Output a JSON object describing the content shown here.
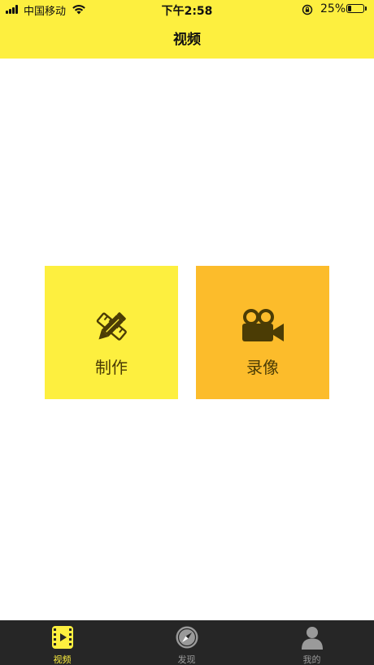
{
  "status_bar": {
    "carrier": "中国移动",
    "time": "下午2:58",
    "battery_percent": "25%",
    "battery_level": 0.25
  },
  "nav": {
    "title": "视频"
  },
  "actions": {
    "make_label": "制作",
    "record_label": "录像"
  },
  "tabbar": {
    "tabs": [
      {
        "label": "视频",
        "icon": "video-film-icon",
        "active": true
      },
      {
        "label": "发现",
        "icon": "compass-icon",
        "active": false
      },
      {
        "label": "我的",
        "icon": "user-icon",
        "active": false
      }
    ]
  },
  "colors": {
    "header_yellow": "#fdef3f",
    "make_tile": "#fdef3f",
    "record_tile": "#fcbc2b",
    "tile_icon": "#4b3c05",
    "tabbar_bg": "#262626",
    "tab_active": "#fdef3f",
    "tab_inactive": "#9a9a9a"
  }
}
